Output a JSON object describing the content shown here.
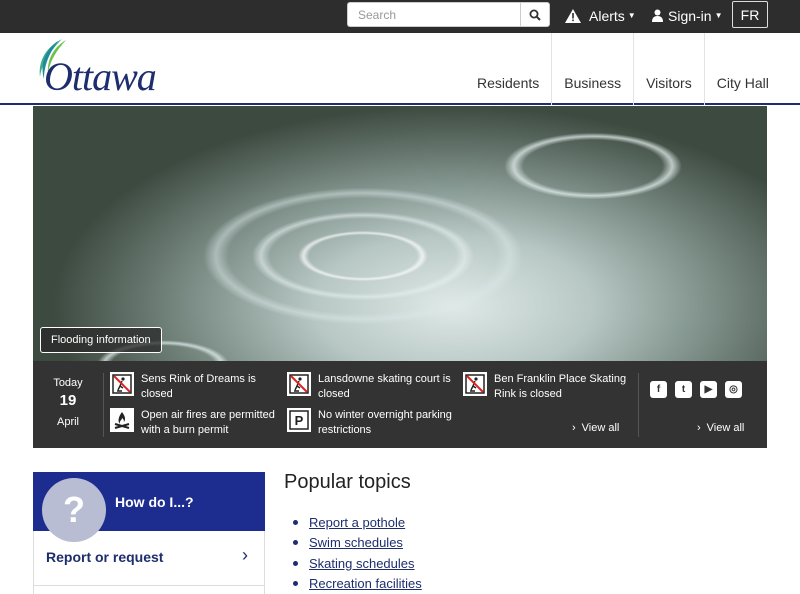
{
  "topbar": {
    "search_placeholder": "Search",
    "alerts_label": "Alerts",
    "signin_label": "Sign-in",
    "language_label": "FR"
  },
  "header": {
    "logo_text": "Ottawa",
    "nav": [
      "Residents",
      "Business",
      "Visitors",
      "City Hall"
    ]
  },
  "hero": {
    "button_label": "Flooding information"
  },
  "status": {
    "today_label": "Today",
    "day": "19",
    "month": "April",
    "items": [
      "Sens Rink of Dreams is closed",
      "Lansdowne skating court is closed",
      "Ben Franklin Place Skating Rink is closed",
      "Open air fires are permitted with a burn permit",
      "No winter overnight parking restrictions"
    ],
    "view_all_label": "View all",
    "social_view_all_label": "View all",
    "social_icons": [
      "facebook-icon",
      "twitter-icon",
      "youtube-icon",
      "instagram-icon"
    ]
  },
  "howdoi": {
    "title": "How do I...?",
    "report_label": "Report or request"
  },
  "popular": {
    "title": "Popular topics",
    "topics": [
      "Report a pothole",
      "Swim schedules",
      "Skating schedules",
      "Recreation facilities"
    ]
  },
  "colors": {
    "navy": "#1d2d6e",
    "howdoi_blue": "#1d2d8f",
    "topbar": "#2d2d2d",
    "status_bar": "#333333"
  }
}
